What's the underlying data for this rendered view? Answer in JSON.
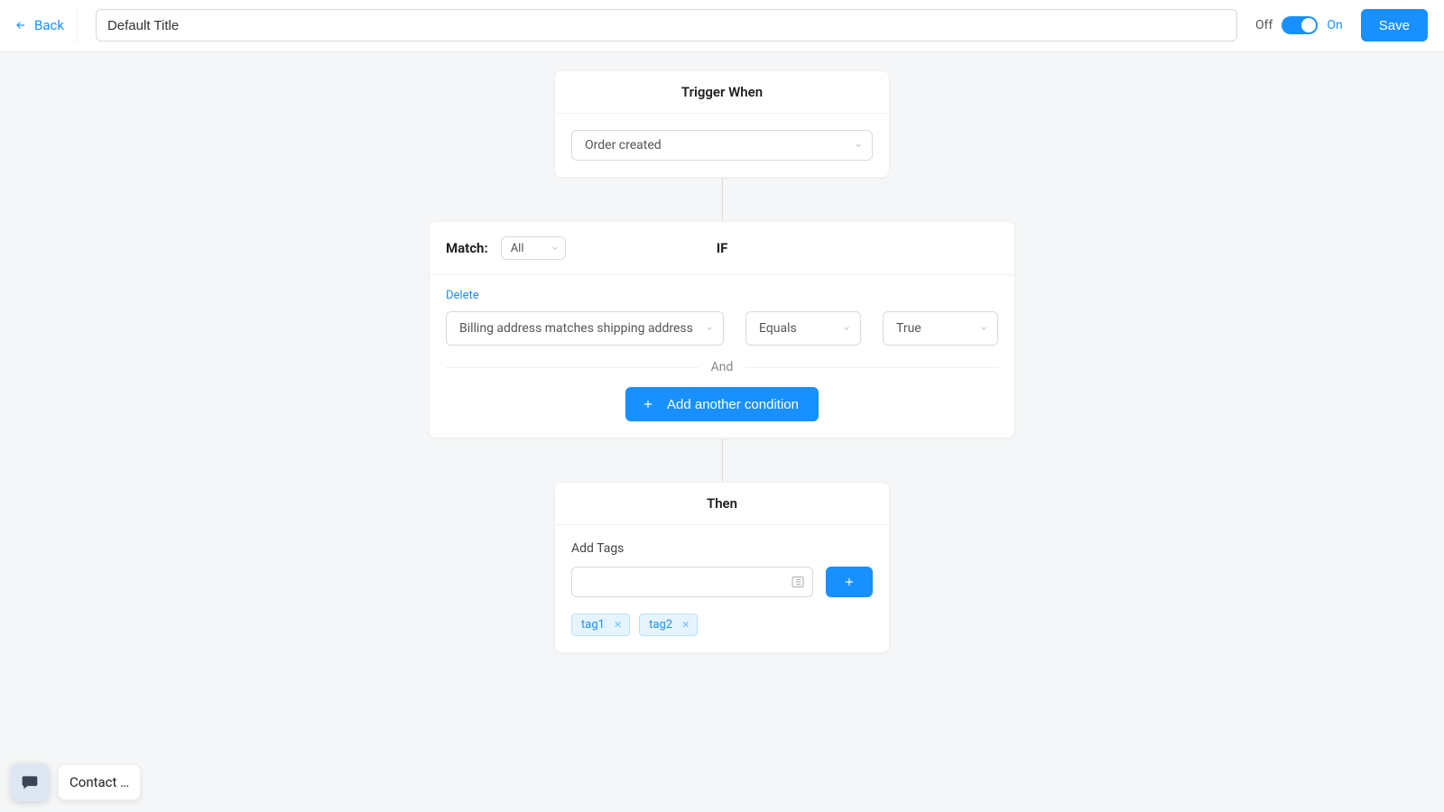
{
  "header": {
    "back_label": "Back",
    "title": "Default Title",
    "off_label": "Off",
    "on_label": "On",
    "save_label": "Save"
  },
  "trigger": {
    "header": "Trigger When",
    "selected": "Order created"
  },
  "conditions": {
    "match_label": "Match:",
    "match_value": "All",
    "if_label": "IF",
    "delete_label": "Delete",
    "rows": [
      {
        "field": "Billing address matches shipping address",
        "operator": "Equals",
        "value": "True"
      }
    ],
    "divider_label": "And",
    "add_label": "Add another condition"
  },
  "then": {
    "header": "Then",
    "add_tags_label": "Add Tags",
    "tags": [
      "tag1",
      "tag2"
    ]
  },
  "chat": {
    "label": "Contact …"
  }
}
